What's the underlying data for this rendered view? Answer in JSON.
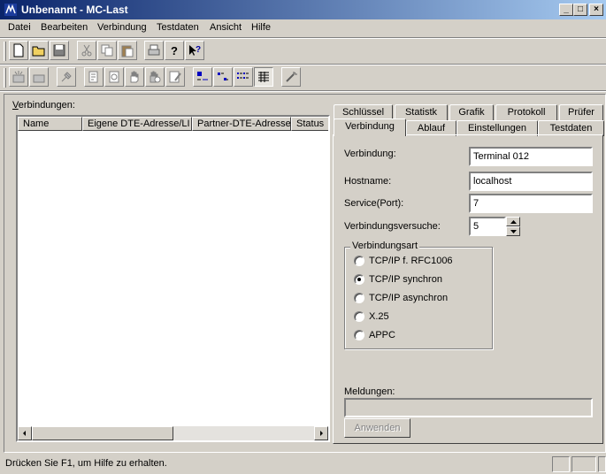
{
  "window": {
    "title": "Unbenannt - MC-Last"
  },
  "menu": [
    "Datei",
    "Bearbeiten",
    "Verbindung",
    "Testdaten",
    "Ansicht",
    "Hilfe"
  ],
  "left": {
    "label": "Verbindungen:",
    "columns": [
      "Name",
      "Eigene DTE-Adresse/LI",
      "Partner-DTE-Adresse",
      "Status"
    ]
  },
  "tabs": {
    "row1": [
      "Schlüssel",
      "Statistk",
      "Grafik",
      "Protokoll",
      "Prüfer"
    ],
    "row2": [
      "Verbindung",
      "Ablauf",
      "Einstellungen",
      "Testdaten"
    ],
    "active": "Verbindung"
  },
  "form": {
    "verbindung_label": "Verbindung:",
    "verbindung_value": "Terminal 012",
    "hostname_label": "Hostname:",
    "hostname_value": "localhost",
    "service_label": "Service(Port):",
    "service_value": "7",
    "versuche_label": "Verbindungsversuche:",
    "versuche_value": "5",
    "group_label": "Verbindungsart",
    "options": [
      "TCP/IP f. RFC1006",
      "TCP/IP synchron",
      "TCP/IP asynchron",
      "X.25",
      "APPC"
    ],
    "selected": "TCP/IP synchron",
    "meldungen_label": "Meldungen:",
    "meldungen_value": "",
    "apply_label": "Anwenden"
  },
  "status": {
    "text": "Drücken Sie F1, um Hilfe zu erhalten."
  }
}
